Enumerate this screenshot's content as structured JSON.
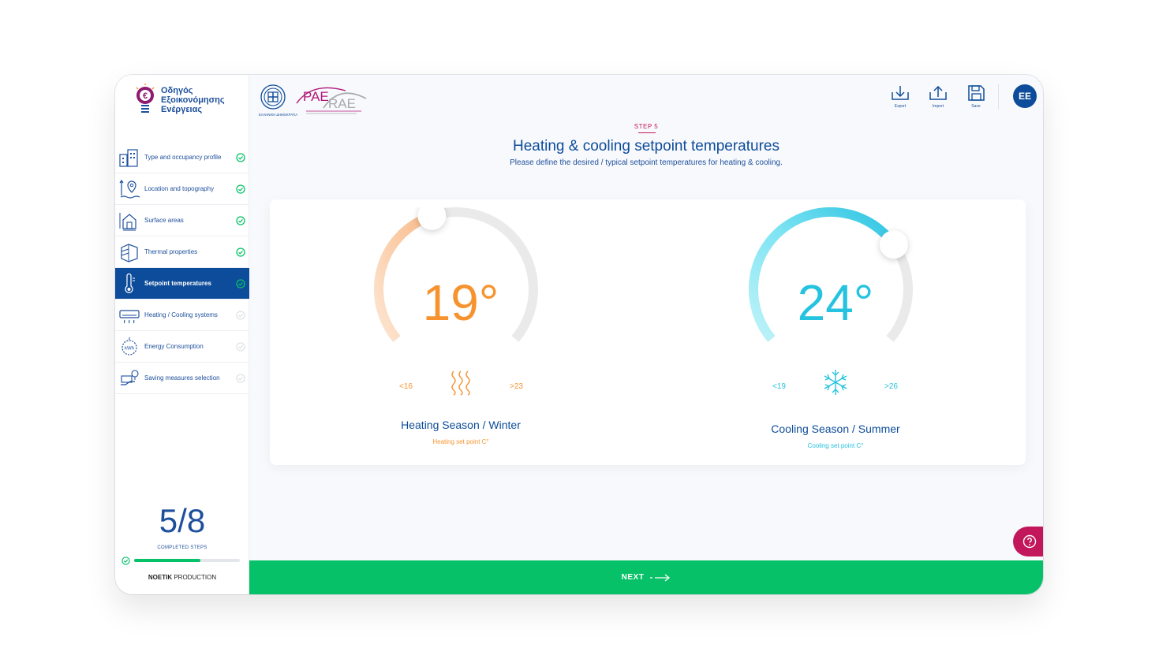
{
  "brand": {
    "line1": "Οδηγός",
    "line2": "Εξοικονόμησης",
    "line3": "Ενέργειας"
  },
  "partners": {
    "hellenic": "ΕΛΛΗΝΙΚΗ ΔΗΜΟΚΡΑΤΙΑ",
    "rae_greek": "ΡΑΕ",
    "rae_latin": "RAE"
  },
  "sidebar": {
    "items": [
      {
        "label": "Type and occupancy profile",
        "status": "done"
      },
      {
        "label": "Location and topography",
        "status": "done"
      },
      {
        "label": "Surface areas",
        "status": "done"
      },
      {
        "label": "Thermal properties",
        "status": "done"
      },
      {
        "label": "Setpoint temperatures",
        "status": "active"
      },
      {
        "label": "Heating / Cooling systems",
        "status": "pending"
      },
      {
        "label": "Energy Consumption",
        "status": "pending"
      },
      {
        "label": "Saving measures selection",
        "status": "pending"
      }
    ],
    "progress": {
      "count": "5/8",
      "caption": "COMPLETED STEPS",
      "fraction": 0.625
    },
    "credit_bold": "NOETIK",
    "credit_rest": " PRODUCTION"
  },
  "toolbar": {
    "export": "Export",
    "import": "Import",
    "save": "Save",
    "avatar": "EE"
  },
  "header": {
    "step": "STEP 5",
    "title": "Heating & cooling setpoint temperatures",
    "subtitle": "Please define the desired / typical setpoint temperatures for heating & cooling."
  },
  "heating": {
    "value": "19°",
    "min": "<16",
    "max": ">23",
    "title": "Heating Season / Winter",
    "subtitle": "Heating set point C°",
    "level": 0.43
  },
  "cooling": {
    "value": "24°",
    "min": "<19",
    "max": ">26",
    "title": "Cooling Season / Summer",
    "subtitle": "Cooling set point C°",
    "level": 0.71
  },
  "colors": {
    "primary": "#0d4c9a",
    "heating": "#f7932f",
    "cooling": "#25c3df",
    "success": "#06c167",
    "accent": "#c2185b"
  },
  "footer": {
    "next": "NEXT"
  }
}
